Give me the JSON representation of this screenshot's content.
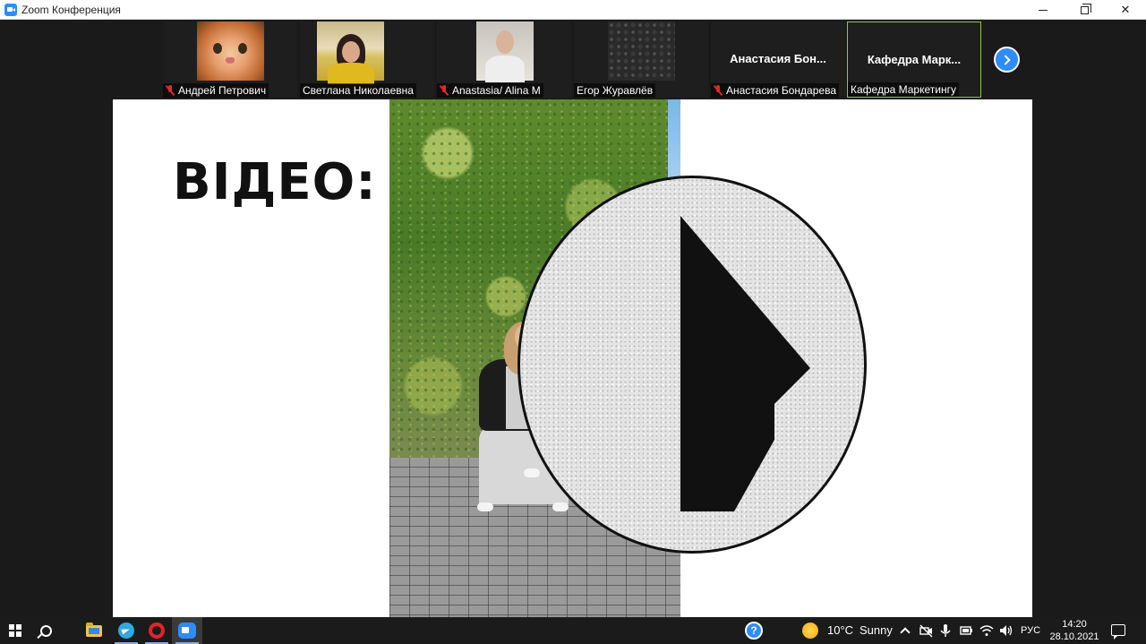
{
  "window": {
    "title": "Zoom Конференция",
    "controls": {
      "minimize_icon": "minimize-icon",
      "restore_icon": "restore-icon",
      "close_glyph": "✕"
    }
  },
  "participants": [
    {
      "name": "Андрей Петрович",
      "muted": true,
      "video": "cat-photo"
    },
    {
      "name": "Светлана Николаевна",
      "muted": false,
      "video": "woman-room"
    },
    {
      "name": "Anastasia/ Alina M",
      "muted": true,
      "video": "person-light"
    },
    {
      "name": "Егор Журавлёв",
      "muted": false,
      "video": "pattern-avatar"
    },
    {
      "name": "Анастасия Бондарева",
      "muted": true,
      "display_name": "Анастасия Бон..."
    },
    {
      "name": "Кафедра Маркетингу",
      "muted": false,
      "display_name": "Кафедра Марк...",
      "active_speaker": true
    }
  ],
  "shared_screen": {
    "heading": "ВІДЕО:"
  },
  "taskbar": {
    "help_glyph": "?",
    "weather": {
      "temp": "10°C",
      "condition": "Sunny"
    },
    "language": "РУС",
    "time": "14:20",
    "date": "28.10.2021"
  },
  "colors": {
    "zoom_blue": "#2d8cff",
    "active_border": "#8fc73e",
    "mute_red": "#e02828"
  }
}
